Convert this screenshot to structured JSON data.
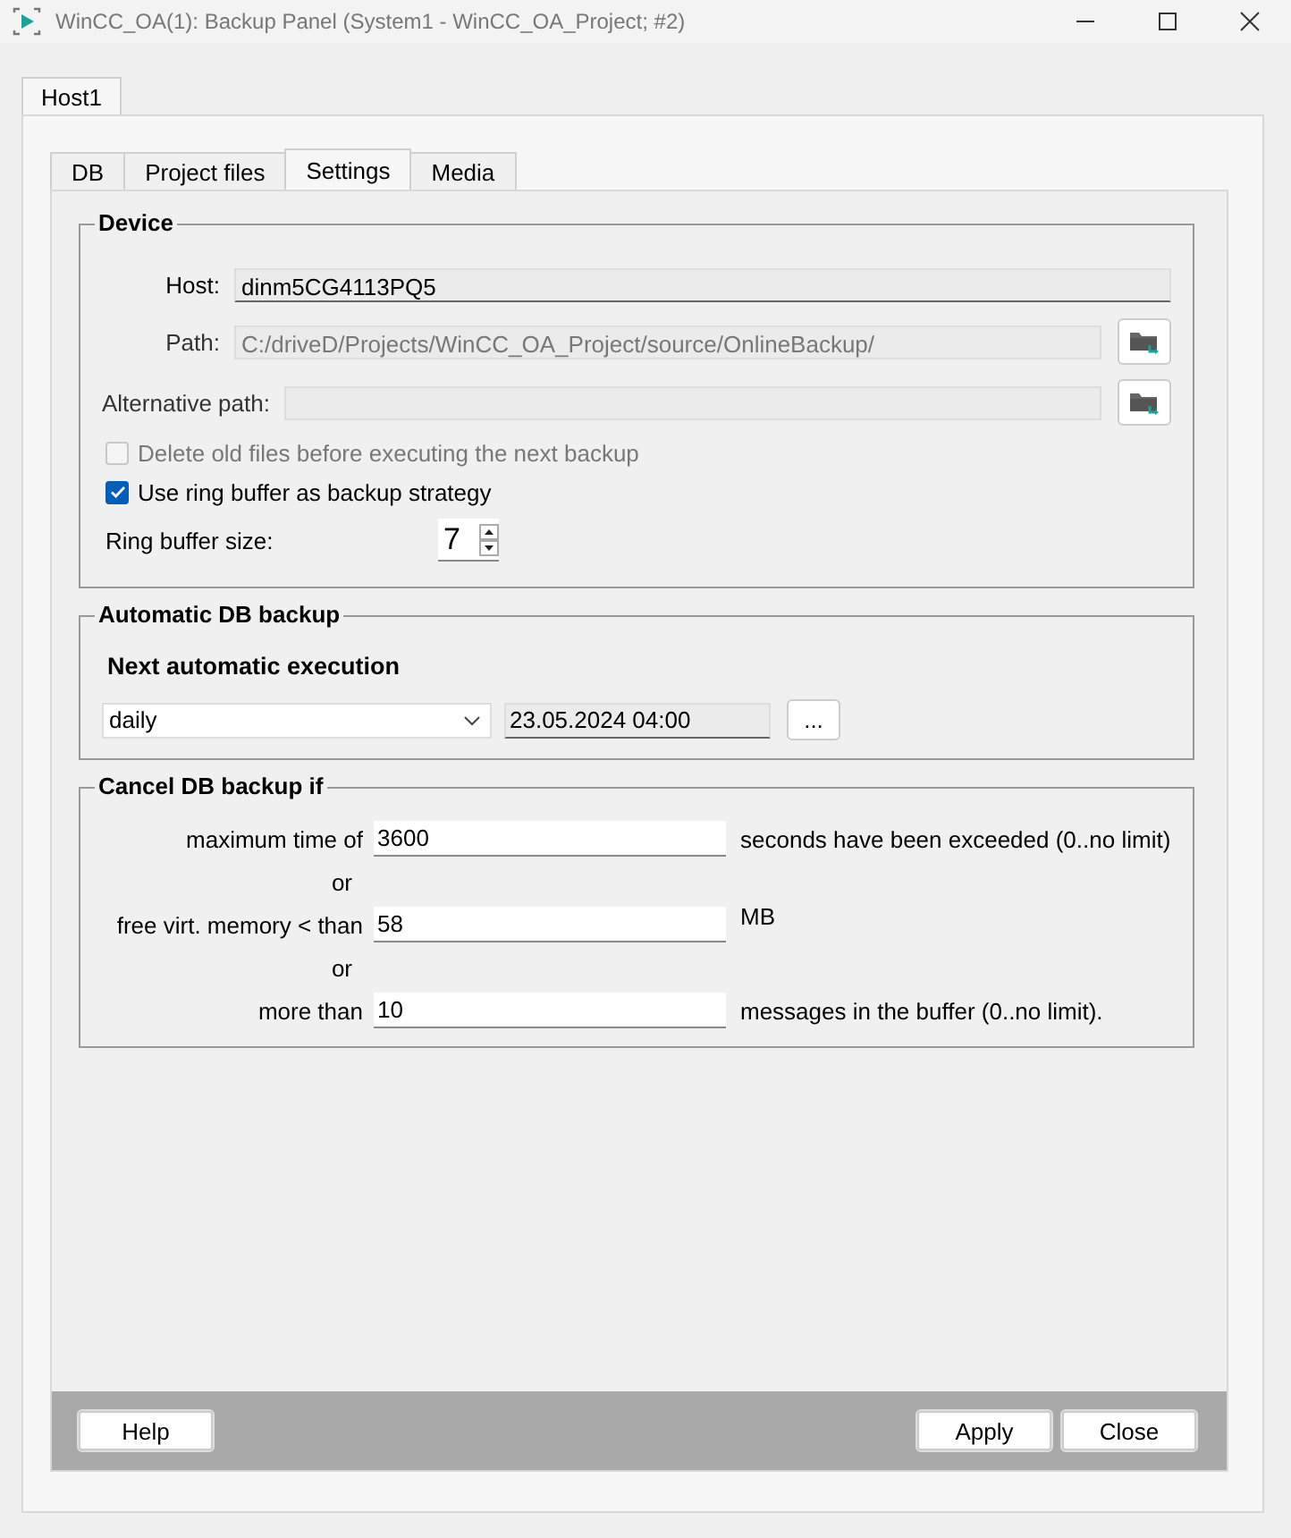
{
  "window": {
    "title": "WinCC_OA(1): Backup Panel (System1 - WinCC_OA_Project; #2)"
  },
  "host_tabs": [
    {
      "label": "Host1",
      "selected": true
    }
  ],
  "tabs": [
    {
      "label": "DB",
      "selected": false
    },
    {
      "label": "Project files",
      "selected": false
    },
    {
      "label": "Settings",
      "selected": true
    },
    {
      "label": "Media",
      "selected": false
    }
  ],
  "device": {
    "title": "Device",
    "fields": [
      {
        "label": "Host:",
        "value": "dinm5CG4113PQ5",
        "disabled": false,
        "browse": false
      },
      {
        "label": "Path:",
        "value": "C:/driveD/Projects/WinCC_OA_Project/source/OnlineBackup/",
        "disabled": true,
        "browse": true
      },
      {
        "label": "Alternative path:",
        "disabled": true,
        "browse": true
      }
    ],
    "checkboxes": [
      {
        "label": "Delete old files before executing the next backup",
        "checked": false,
        "disabled": true
      },
      {
        "label": "Use ring buffer as backup strategy",
        "checked": true,
        "disabled": false
      }
    ],
    "ring_buffer_size": {
      "label": "Ring buffer size:",
      "value": "7"
    }
  },
  "automatic_backup": {
    "title": "Automatic DB backup",
    "subtitle": "Next automatic execution",
    "frequency": "daily",
    "next_time": "23.05.2024 04:00",
    "button": "..."
  },
  "cancel_backup": {
    "title": "Cancel DB backup if",
    "rows": [
      {
        "kind": "field",
        "label": "maximum time of",
        "value": "3600",
        "suffix": "seconds have been exceeded (0..no limit)"
      },
      {
        "kind": "separator",
        "text": "or"
      },
      {
        "kind": "field",
        "label": "free virt. memory < than",
        "value": "58",
        "suffix": "MB"
      },
      {
        "kind": "separator",
        "text": "or"
      },
      {
        "kind": "field",
        "label": "more than",
        "value": "10",
        "suffix": "messages in the buffer (0..no limit)."
      }
    ]
  },
  "buttons_left": [
    "Help"
  ],
  "buttons_right": [
    "Apply",
    "Close"
  ]
}
